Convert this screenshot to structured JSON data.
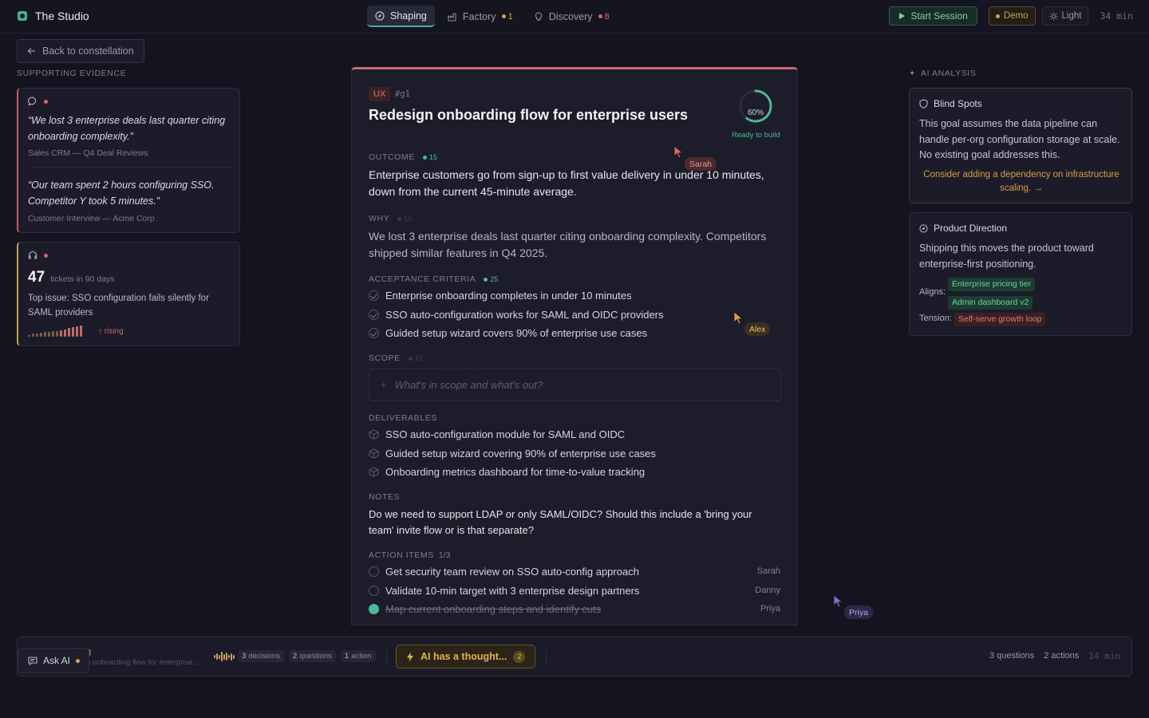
{
  "app": {
    "title": "The Studio"
  },
  "tabs": [
    {
      "label": "Shaping",
      "count": ""
    },
    {
      "label": "Factory",
      "count": "1"
    },
    {
      "label": "Discovery",
      "count": "8"
    }
  ],
  "topbar": {
    "start_session": "Start Session",
    "demo": "Demo",
    "theme": "Light",
    "timer": "34 min"
  },
  "left": {
    "back": "Back to constellation",
    "evidence_label": "SUPPORTING EVIDENCE",
    "card1": {
      "quote1": "“We lost 3 enterprise deals last quarter citing onboarding complexity.”",
      "source1": "Sales CRM — Q4 Deal Reviews",
      "quote2": "“Our team spent 2 hours configuring SSO. Competitor Y took 5 minutes.”",
      "source2": "Customer Interview — Acme Corp"
    },
    "card2": {
      "number": "47",
      "number_sub": "tickets in 90 days",
      "issue": "Top issue: SSO configuration fails silently for SAML providers",
      "trend": "↑ rising",
      "sparkline": [
        2,
        3,
        3,
        4,
        5,
        5,
        6,
        6,
        7,
        8,
        9,
        10,
        11,
        12
      ]
    }
  },
  "goal": {
    "tag": "UX",
    "id": "#g1",
    "title": "Redesign onboarding flow for enterprise users",
    "progress": 60,
    "progress_label": "60%",
    "ready": "Ready to build",
    "outcome_label": "OUTCOME",
    "outcome_pts": "15",
    "outcome": "Enterprise customers go from sign-up to first value delivery in under 10 minutes, down from the current 45-minute average.",
    "why_label": "WHY",
    "why_pts": "15",
    "why": "We lost 3 enterprise deals last quarter citing onboarding complexity. Competitors shipped similar features in Q4 2025.",
    "criteria_label": "ACCEPTANCE CRITERIA",
    "criteria_pts": "25",
    "criteria": [
      "Enterprise onboarding completes in under 10 minutes",
      "SSO auto-configuration works for SAML and OIDC providers",
      "Guided setup wizard covers 90% of enterprise use cases"
    ],
    "scope_label": "SCOPE",
    "scope_pts": "15",
    "scope_placeholder": "What's in scope and what's out?",
    "deliverables_label": "DELIVERABLES",
    "deliverables": [
      "SSO auto-configuration module for SAML and OIDC",
      "Guided setup wizard covering 90% of enterprise use cases",
      "Onboarding metrics dashboard for time-to-value tracking"
    ],
    "notes_label": "NOTES",
    "notes": "Do we need to support LDAP or only SAML/OIDC? Should this include a 'bring your team' invite flow or is that separate?",
    "actions_label": "ACTION ITEMS",
    "actions_count": "1/3",
    "actions": [
      {
        "text": "Get security team review on SSO auto-config approach",
        "owner": "Sarah",
        "done": false
      },
      {
        "text": "Validate 10-min target with 3 enterprise design partners",
        "owner": "Danny",
        "done": false
      },
      {
        "text": "Map current onboarding steps and identify cuts",
        "owner": "Priya",
        "done": true
      }
    ]
  },
  "cursors": [
    {
      "name": "Sarah",
      "color": "#d26a6a"
    },
    {
      "name": "Alex",
      "color": "#d9a43f"
    },
    {
      "name": "Priya",
      "color": "#8a6ad6"
    }
  ],
  "ai": {
    "label": "AI ANALYSIS",
    "blind_title": "Blind Spots",
    "blind_body": "This goal assumes the data pipeline can handle per-org configuration storage at scale. No existing goal addresses this.",
    "blind_link": "Consider adding a dependency on infrastructure scaling. →",
    "dir_title": "Product Direction",
    "dir_body": "Shipping this moves the product toward enterprise-first positioning.",
    "aligns_label": "Aligns:",
    "aligns": [
      "Enterprise pricing tier",
      "Admin dashboard v2"
    ],
    "tension_label": "Tension:",
    "tension": "Self-serve growth loop"
  },
  "bottom": {
    "ask_ai": "Ask AI",
    "title_frag": "g",
    "subtitle_frag": "n onboarding flow for enterprise ...",
    "decisions": {
      "n": "3",
      "label": "decisions"
    },
    "questions": {
      "n": "2",
      "label": "questions"
    },
    "actions": {
      "n": "1",
      "label": "action"
    },
    "thought": "AI has a thought...",
    "thought_count": "2",
    "right_questions": "3 questions",
    "right_actions": "2 actions",
    "right_time": "14 min"
  },
  "colors": {
    "accent_green": "#4cba98",
    "accent_red": "#c96a6a",
    "accent_amber": "#d9a43f",
    "background": "#141420"
  }
}
